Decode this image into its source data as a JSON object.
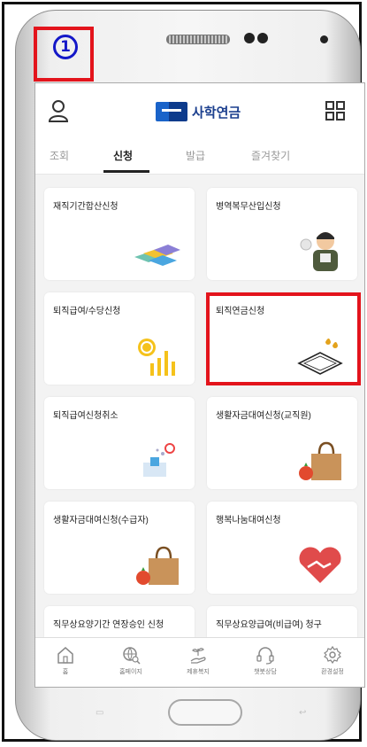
{
  "step_marker": "1",
  "header": {
    "logo_text": "사학연금",
    "user_icon": "user-icon",
    "menu_icon": "grid-menu-icon"
  },
  "tabs": [
    {
      "label": "조회",
      "active": false
    },
    {
      "label": "신청",
      "active": true
    },
    {
      "label": "발급",
      "active": false
    },
    {
      "label": "즐겨찾기",
      "active": false
    }
  ],
  "cards": [
    {
      "label": "재직기간합산신청",
      "icon": "folders-icon"
    },
    {
      "label": "병역복무산입신청",
      "icon": "soldier-icon"
    },
    {
      "label": "퇴직급여/수당신청",
      "icon": "coin-chart-icon"
    },
    {
      "label": "퇴직연금신청",
      "icon": "tablet-coins-icon"
    },
    {
      "label": "퇴직급여신청취소",
      "icon": "cancel-document-icon"
    },
    {
      "label": "생활자금대여신청(교직원)",
      "icon": "shopping-bag-icon"
    },
    {
      "label": "생활자금대여신청(수급자)",
      "icon": "shopping-bag-icon"
    },
    {
      "label": "행복나눔대여신청",
      "icon": "heart-handshake-icon"
    },
    {
      "label": "직무상요양기간 연장승인 신청",
      "icon": ""
    },
    {
      "label": "직무상요양급여(비급여) 청구",
      "icon": ""
    }
  ],
  "bottom_nav": [
    {
      "label": "홈",
      "icon": "home-icon"
    },
    {
      "label": "홈페이지",
      "icon": "globe-search-icon"
    },
    {
      "label": "제휴복지",
      "icon": "hand-plant-icon"
    },
    {
      "label": "챗봇상담",
      "icon": "headset-icon"
    },
    {
      "label": "환경설정",
      "icon": "gear-icon"
    }
  ],
  "colors": {
    "highlight": "#e3141c",
    "step_marker": "#1418c8",
    "brand": "#1b3f8e"
  }
}
